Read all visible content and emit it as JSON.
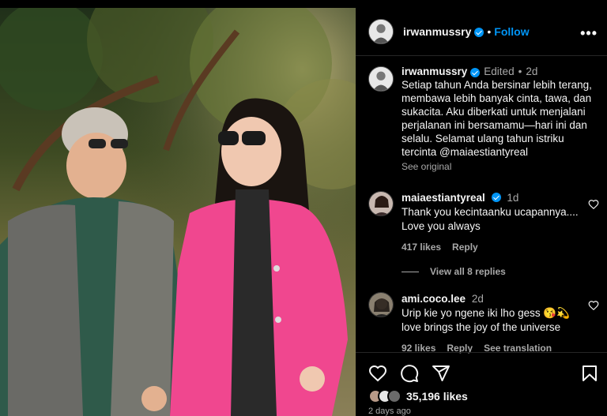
{
  "post": {
    "username": "irwanmussry",
    "follow_label": "Follow",
    "more_label": "•••",
    "separator": "•"
  },
  "caption": {
    "username": "irwanmussry",
    "edited_label": "Edited",
    "age": "2d",
    "text": "Setiap tahun Anda bersinar lebih terang, membawa lebih banyak cinta, tawa, dan sukacita. Aku diberkati untuk menjalani perjalanan ini bersamamu—hari ini dan selalu. Selamat ulang tahun istriku tercinta @maiaestiantyreal",
    "see_original": "See original"
  },
  "comments": [
    {
      "username": "maiaestiantyreal",
      "verified": true,
      "age": "1d",
      "text": "Thank you kecintaanku ucapannya.... Love you always",
      "likes": "417 likes",
      "reply": "Reply",
      "translate": ""
    },
    {
      "username": "ami.coco.lee",
      "verified": false,
      "age": "2d",
      "text": "Urip kie yo ngene iki lho gess 😘💫 love brings the joy of the universe",
      "likes": "92 likes",
      "reply": "Reply",
      "translate": "See translation"
    }
  ],
  "view_replies": "View all 8 replies",
  "footer": {
    "likes_count": "35,196 likes",
    "time_ago": "2 days ago"
  },
  "colors": {
    "accent": "#0095f6",
    "pink_jacket": "#f0478f",
    "background": "#000000"
  },
  "icons": [
    "heart-icon",
    "comment-icon",
    "share-icon",
    "bookmark-icon",
    "verified-badge-icon",
    "more-options-icon"
  ]
}
